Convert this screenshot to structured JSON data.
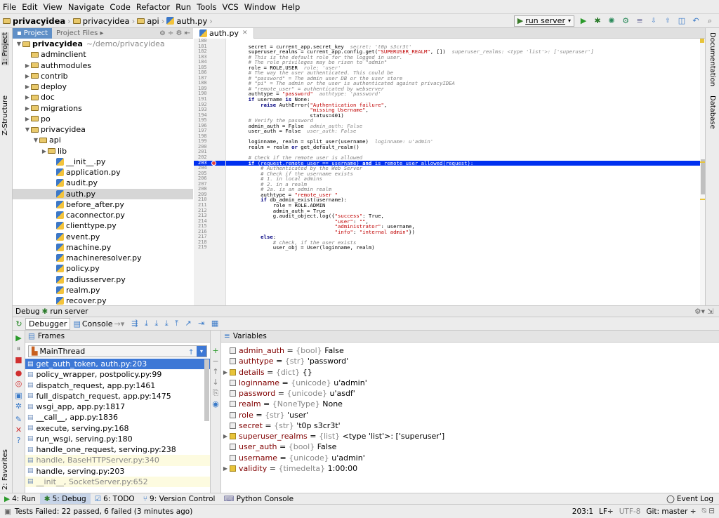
{
  "menu": [
    "File",
    "Edit",
    "View",
    "Navigate",
    "Code",
    "Refactor",
    "Run",
    "Tools",
    "VCS",
    "Window",
    "Help"
  ],
  "breadcrumb": [
    "privacyidea",
    "privacyidea",
    "api",
    "auth.py"
  ],
  "run_config": "run server",
  "left_tabs": {
    "project": "1: Project",
    "structure": "Z-Structure",
    "favorites": "2: Favorites"
  },
  "right_tabs": {
    "documentation": "Documentation",
    "database": "Database"
  },
  "project_panel": {
    "tab_project": "Project",
    "tab_files": "Project Files"
  },
  "tree": [
    {
      "label": "privacyidea",
      "extra": "~/demo/privacyidea",
      "indent": 0,
      "type": "folder",
      "arrow": "down",
      "bold": true
    },
    {
      "label": "adminclient",
      "indent": 1,
      "type": "folder",
      "arrow": ""
    },
    {
      "label": "authmodules",
      "indent": 1,
      "type": "folder",
      "arrow": "right"
    },
    {
      "label": "contrib",
      "indent": 1,
      "type": "folder",
      "arrow": "right"
    },
    {
      "label": "deploy",
      "indent": 1,
      "type": "folder",
      "arrow": "right"
    },
    {
      "label": "doc",
      "indent": 1,
      "type": "folder",
      "arrow": "right"
    },
    {
      "label": "migrations",
      "indent": 1,
      "type": "folder",
      "arrow": "right"
    },
    {
      "label": "po",
      "indent": 1,
      "type": "folder",
      "arrow": "right"
    },
    {
      "label": "privacyidea",
      "indent": 1,
      "type": "folder",
      "arrow": "down"
    },
    {
      "label": "api",
      "indent": 2,
      "type": "folder",
      "arrow": "down"
    },
    {
      "label": "lib",
      "indent": 3,
      "type": "folder",
      "arrow": "right"
    },
    {
      "label": "__init__.py",
      "indent": 4,
      "type": "py"
    },
    {
      "label": "application.py",
      "indent": 4,
      "type": "py"
    },
    {
      "label": "audit.py",
      "indent": 4,
      "type": "py"
    },
    {
      "label": "auth.py",
      "indent": 4,
      "type": "py",
      "selected": true
    },
    {
      "label": "before_after.py",
      "indent": 4,
      "type": "py"
    },
    {
      "label": "caconnector.py",
      "indent": 4,
      "type": "py"
    },
    {
      "label": "clienttype.py",
      "indent": 4,
      "type": "py"
    },
    {
      "label": "event.py",
      "indent": 4,
      "type": "py"
    },
    {
      "label": "machine.py",
      "indent": 4,
      "type": "py"
    },
    {
      "label": "machineresolver.py",
      "indent": 4,
      "type": "py"
    },
    {
      "label": "policy.py",
      "indent": 4,
      "type": "py"
    },
    {
      "label": "radiusserver.py",
      "indent": 4,
      "type": "py"
    },
    {
      "label": "realm.py",
      "indent": 4,
      "type": "py"
    },
    {
      "label": "recover.py",
      "indent": 4,
      "type": "py"
    }
  ],
  "editor_tab": "auth.py",
  "code": [
    {
      "n": "180",
      "t": ""
    },
    {
      "n": "181",
      "h": "    secret = current_app.secret_key  <span class='hint'>secret: 't0p s3cr3t'</span>"
    },
    {
      "n": "182",
      "h": "    superuser_realms = current_app.config.get(<span class='st'>\"SUPERUSER_REALM\"</span>, [])  <span class='hint'>superuser_realms: &lt;type 'list'&gt;: ['superuser']</span>"
    },
    {
      "n": "183",
      "h": "    <span class='cm'># This is the default role for the logged in user.</span>"
    },
    {
      "n": "184",
      "h": "    <span class='cm'># The role privileges may be risen to \"admin\"</span>"
    },
    {
      "n": "185",
      "h": "    role = ROLE.USER  <span class='hint'>role: 'user'</span>"
    },
    {
      "n": "186",
      "h": "    <span class='cm'># The way the user authenticated. This could be</span>"
    },
    {
      "n": "187",
      "h": "    <span class='cm'># \"password\" = The admin user DB or the user store</span>"
    },
    {
      "n": "188",
      "h": "    <span class='cm'># \"pi\" = The admin or the user is authenticated against privacyIDEA</span>"
    },
    {
      "n": "189",
      "h": "    <span class='cm'># \"remote_user\" = authenticated by webserver</span>"
    },
    {
      "n": "190",
      "h": "    authtype = <span class='st'>\"password\"</span>  <span class='hint'>authtype: 'password'</span>"
    },
    {
      "n": "191",
      "h": "    <span class='kw'>if</span> username <span class='kw'>is</span> None:"
    },
    {
      "n": "192",
      "h": "        <span class='kw'>raise</span> AuthError(<span class='st'>\"Authentication failure\"</span>,"
    },
    {
      "n": "193",
      "h": "                        <span class='st'>\"missing Username\"</span>,"
    },
    {
      "n": "194",
      "h": "                        status=401)"
    },
    {
      "n": "195",
      "h": "    <span class='cm'># Verify the password</span>"
    },
    {
      "n": "196",
      "h": "    admin_auth = False  <span class='hint'>admin_auth: False</span>"
    },
    {
      "n": "197",
      "h": "    user_auth = False  <span class='hint'>user_auth: False</span>"
    },
    {
      "n": "198",
      "h": ""
    },
    {
      "n": "199",
      "h": "    loginname, realm = split_user(username)  <span class='hint'>loginname: u'admin'</span>"
    },
    {
      "n": "200",
      "h": "    realm = realm <span class='kw'>or</span> get_default_realm()"
    },
    {
      "n": "201",
      "h": ""
    },
    {
      "n": "202",
      "h": "    <span class='cm'># Check if the remote user is allowed</span>"
    },
    {
      "n": "203",
      "h": "    <b>if</b> (request.remote_user == username) <b>and</b> is_remote_user_allowed(request):",
      "hl": true
    },
    {
      "n": "204",
      "h": "        <span class='cm'># Authenticated by the Web Server</span>"
    },
    {
      "n": "205",
      "h": "        <span class='cm'># Check if the username exists</span>"
    },
    {
      "n": "206",
      "h": "        <span class='cm'># 1. in local admins</span>"
    },
    {
      "n": "207",
      "h": "        <span class='cm'># 2. in a realm</span>"
    },
    {
      "n": "208",
      "h": "        <span class='cm'># 2a. is an admin realm</span>"
    },
    {
      "n": "209",
      "h": "        authtype = <span class='st'>\"remote_user \"</span>"
    },
    {
      "n": "210",
      "h": "        <span class='kw'>if</span> db_admin_exist(username):"
    },
    {
      "n": "211",
      "h": "            role = ROLE.ADMIN"
    },
    {
      "n": "212",
      "h": "            admin_auth = True"
    },
    {
      "n": "213",
      "h": "            g.audit_object.log({<span class='st'>\"success\"</span>: True,"
    },
    {
      "n": "214",
      "h": "                                <span class='st'>\"user\"</span>: <span class='st'>\"\"</span>,"
    },
    {
      "n": "215",
      "h": "                                <span class='st'>\"administrator\"</span>: username,"
    },
    {
      "n": "216",
      "h": "                                <span class='st'>\"info\"</span>: <span class='st'>\"internal admin\"</span>})"
    },
    {
      "n": "217",
      "h": "        <span class='kw'>else</span>:"
    },
    {
      "n": "218",
      "h": "            <span class='cm'># check, if the user exists</span>"
    },
    {
      "n": "219",
      "h": "            user_obj = User(loginname, realm)"
    }
  ],
  "debug": {
    "title": "Debug",
    "config": "run server",
    "tab_debugger": "Debugger",
    "tab_console": "Console",
    "frames_title": "Frames",
    "thread": "MainThread",
    "frames": [
      {
        "label": "get_auth_token, auth.py:203",
        "state": "sel"
      },
      {
        "label": "policy_wrapper, postpolicy.py:99",
        "state": ""
      },
      {
        "label": "dispatch_request, app.py:1461",
        "state": ""
      },
      {
        "label": "full_dispatch_request, app.py:1475",
        "state": ""
      },
      {
        "label": "wsgi_app, app.py:1817",
        "state": ""
      },
      {
        "label": "__call__, app.py:1836",
        "state": ""
      },
      {
        "label": "execute, serving.py:168",
        "state": ""
      },
      {
        "label": "run_wsgi, serving.py:180",
        "state": ""
      },
      {
        "label": "handle_one_request, serving.py:238",
        "state": ""
      },
      {
        "label": "handle, BaseHTTPServer.py:340",
        "state": "lib"
      },
      {
        "label": "handle, serving.py:203",
        "state": ""
      },
      {
        "label": "__init__, SocketServer.py:652",
        "state": "lib"
      }
    ],
    "vars_title": "Variables",
    "variables": [
      {
        "name": "admin_auth",
        "type": "{bool}",
        "value": "False",
        "exp": false
      },
      {
        "name": "authtype",
        "type": "{str}",
        "value": "'password'",
        "exp": false
      },
      {
        "name": "details",
        "type": "{dict}",
        "value": "{}",
        "exp": true
      },
      {
        "name": "loginname",
        "type": "{unicode}",
        "value": "u'admin'",
        "exp": false
      },
      {
        "name": "password",
        "type": "{unicode}",
        "value": "u'asdf'",
        "exp": false
      },
      {
        "name": "realm",
        "type": "{NoneType}",
        "value": "None",
        "exp": false
      },
      {
        "name": "role",
        "type": "{str}",
        "value": "'user'",
        "exp": false
      },
      {
        "name": "secret",
        "type": "{str}",
        "value": "'t0p s3cr3t'",
        "exp": false
      },
      {
        "name": "superuser_realms",
        "type": "{list}",
        "value": "<type 'list'>: ['superuser']",
        "exp": true
      },
      {
        "name": "user_auth",
        "type": "{bool}",
        "value": "False",
        "exp": false
      },
      {
        "name": "username",
        "type": "{unicode}",
        "value": "u'admin'",
        "exp": false
      },
      {
        "name": "validity",
        "type": "{timedelta}",
        "value": "1:00:00",
        "exp": true
      }
    ]
  },
  "tool_buttons": [
    {
      "label": "4: Run",
      "active": false
    },
    {
      "label": "5: Debug",
      "active": true
    },
    {
      "label": "6: TODO",
      "active": false
    },
    {
      "label": "9: Version Control",
      "active": false
    },
    {
      "label": "Python Console",
      "active": false
    }
  ],
  "event_log": "Event Log",
  "status": {
    "message": "Tests Failed: 22 passed, 6 failed (3 minutes ago)",
    "position": "203:1",
    "line_sep": "LF÷",
    "encoding": "UTF-8",
    "git": "Git: master ÷"
  },
  "colors": {
    "highlight": "#0030f0",
    "selected_frame": "#3d78d6",
    "accent": "#5f8fc7"
  }
}
